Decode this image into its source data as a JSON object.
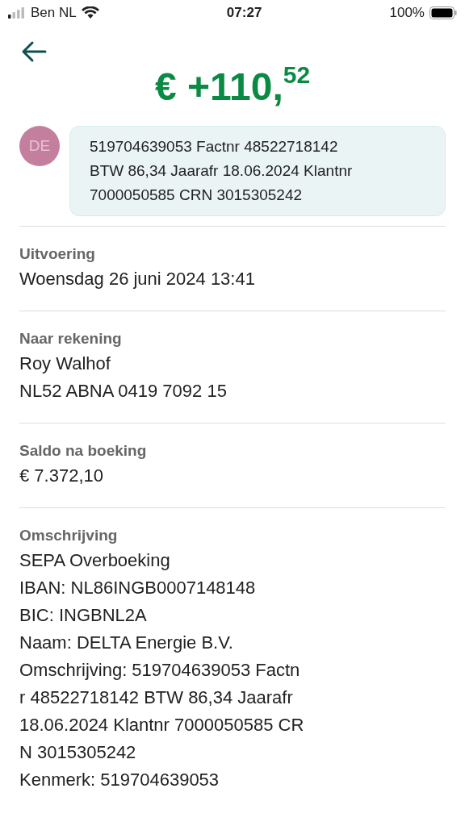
{
  "status_bar": {
    "carrier": "Ben NL",
    "time": "07:27",
    "battery": "100%"
  },
  "amount": "€ +110,$^{52}$",
  "counterparty": {
    "initials": "DE",
    "note_lines": [
      "519704639053 Factnr 48522718142",
      "BTW 86,34 Jaarafr 18.06.2024 Klantnr",
      "7000050585 CRN 3015305242"
    ]
  },
  "sections": [
    {
      "label": "Uitvoering",
      "lines": [
        "Woensdag 26 juni 2024 13:41"
      ]
    },
    {
      "label": "Naar rekening",
      "lines": [
        "Roy Walhof",
        "NL52 ABNA 0419 7092 15"
      ]
    },
    {
      "label": "Saldo na boeking",
      "lines": [
        "€ 7.372,10"
      ]
    },
    {
      "label": "Omschrijving",
      "lines": [
        "SEPA Overboeking",
        "IBAN: NL86INGB0007148148",
        "BIC: INGBNL2A",
        "Naam: DELTA Energie B.V.",
        "Omschrijving: 519704639053 Factn",
        "r 48522718142 BTW 86,34 Jaarafr",
        "18.06.2024 Klantnr 7000050585 CR",
        "N 3015305242",
        "Kenmerk: 519704639053"
      ]
    }
  ]
}
